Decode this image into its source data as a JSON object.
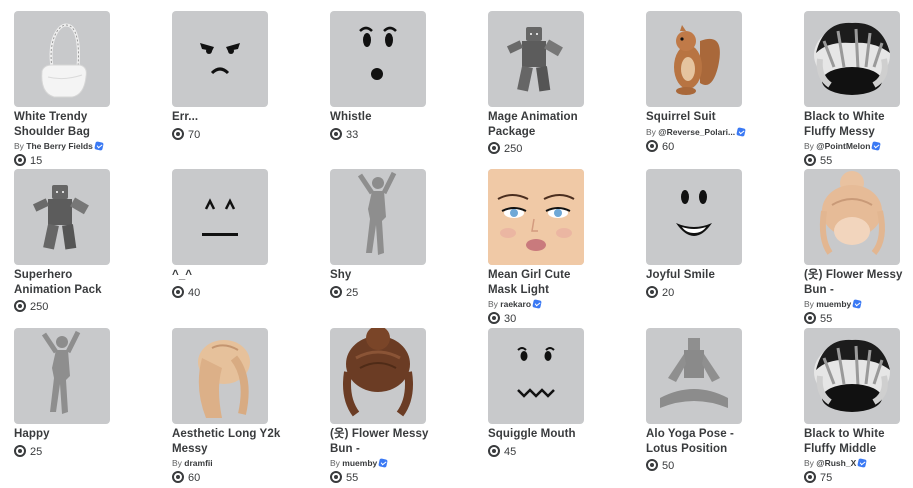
{
  "items": [
    {
      "name": "White Trendy Shoulder Bag",
      "creator": "The Berry Fields",
      "verified": true,
      "price": "15",
      "icon": "shoulder-bag"
    },
    {
      "name": "Err...",
      "creator": "",
      "verified": false,
      "price": "70",
      "icon": "face-err"
    },
    {
      "name": "Whistle",
      "creator": "",
      "verified": false,
      "price": "33",
      "icon": "face-whistle"
    },
    {
      "name": "Mage Animation Package",
      "creator": "",
      "verified": false,
      "price": "250",
      "icon": "animation-figure"
    },
    {
      "name": "Squirrel Suit",
      "creator": "@Reverse_Polari...",
      "verified": true,
      "price": "60",
      "icon": "squirrel"
    },
    {
      "name": "Black to White Fluffy Messy",
      "creator": "@PointMelon",
      "verified": true,
      "price": "55",
      "icon": "hair-bw"
    },
    {
      "name": "Superhero Animation Pack",
      "creator": "",
      "verified": false,
      "price": "250",
      "icon": "animation-figure"
    },
    {
      "name": "^_^",
      "creator": "",
      "verified": false,
      "price": "40",
      "icon": "face-happy-eyes"
    },
    {
      "name": "Shy",
      "creator": "",
      "verified": false,
      "price": "25",
      "icon": "silhouette"
    },
    {
      "name": "Mean Girl Cute Mask Light",
      "creator": "raekaro",
      "verified": true,
      "price": "30",
      "icon": "face-mask"
    },
    {
      "name": "Joyful Smile",
      "creator": "",
      "verified": false,
      "price": "20",
      "icon": "face-smile"
    },
    {
      "name": "(옷) Flower Messy Bun -",
      "creator": "muemby",
      "verified": true,
      "price": "55",
      "icon": "hair-blonde"
    },
    {
      "name": "Happy",
      "creator": "",
      "verified": false,
      "price": "25",
      "icon": "silhouette"
    },
    {
      "name": "Aesthetic Long Y2k Messy",
      "creator": "dramfii",
      "verified": false,
      "price": "60",
      "icon": "hair-long"
    },
    {
      "name": "(옷) Flower Messy Bun -",
      "creator": "muemby",
      "verified": true,
      "price": "55",
      "icon": "hair-brown"
    },
    {
      "name": "Squiggle Mouth",
      "creator": "",
      "verified": false,
      "price": "45",
      "icon": "face-squiggle"
    },
    {
      "name": "Alo Yoga Pose - Lotus Position",
      "creator": "",
      "verified": false,
      "price": "50",
      "icon": "yoga-figure"
    },
    {
      "name": "Black to White Fluffy Middle",
      "creator": "@Rush_X",
      "verified": true,
      "price": "75",
      "icon": "hair-bw"
    }
  ],
  "by_label": "By"
}
